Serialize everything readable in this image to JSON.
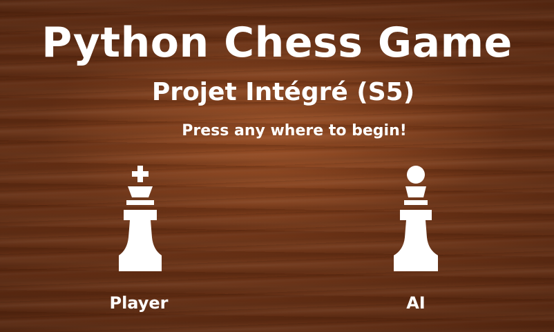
{
  "title": "Python Chess Game",
  "subtitle": "Projet Intégré (S5)",
  "prompt": "Press any where to begin!",
  "players": {
    "player": {
      "label": "Player",
      "icon": "chess-king-icon"
    },
    "ai": {
      "label": "AI",
      "icon": "chess-pawn-icon"
    }
  },
  "colors": {
    "text": "#ffffff",
    "background_wood": "#5b2a12"
  }
}
